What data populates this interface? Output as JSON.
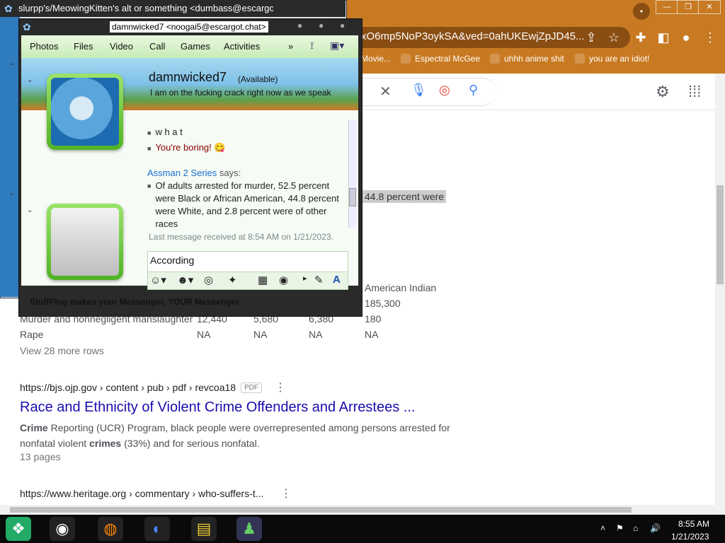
{
  "chrome": {
    "url": "xO6mp5NoP3oykSA&ved=0ahUKEwjZpJD45...",
    "profile_initial": "•",
    "window_buttons": [
      "—",
      "❐",
      "✕"
    ],
    "bookmarks": [
      {
        "label": "Movie..."
      },
      {
        "label": "Espectral McGee"
      },
      {
        "label": "uhhh anime shit"
      },
      {
        "label": "you are an idiot!"
      }
    ]
  },
  "search_page": {
    "highlighted_snippet": "44.8 percent were",
    "table": {
      "header_extra": "American Indian",
      "rows": [
        {
          "label": "",
          "cells": [
            "",
            "",
            "",
            "185,300"
          ]
        },
        {
          "label": "Murder and nonnegligent manslaughter",
          "cells": [
            "12,440",
            "5,680",
            "6,380",
            "180"
          ]
        },
        {
          "label": "Rape",
          "cells": [
            "NA",
            "NA",
            "NA",
            "NA"
          ]
        }
      ],
      "view_more": "View 28 more rows"
    },
    "result1": {
      "cite": "https://bjs.ojp.gov › content › pub › pdf › revcoa18",
      "badge": "PDF",
      "title": "Race and Ethnicity of Violent Crime Offenders and Arrestees ...",
      "snippet_bold1": "Crime",
      "snippet_text1": " Reporting (UCR) Program, black people were overrepresented among persons arrested for nonfatal violent ",
      "snippet_bold2": "crimes",
      "snippet_text2": " (33%) and for serious nonfatal.",
      "pages": "13 pages"
    },
    "result2": {
      "cite": "https://www.heritage.org › commentary › who-suffers-t..."
    }
  },
  "bg_window": {
    "title": "slurpp's/MeowingKitten's alt or something <dumbass@escargot..."
  },
  "messenger": {
    "title": "damnwicked7 <noogai5@escargot.chat>",
    "menu": [
      "Photos",
      "Files",
      "Video",
      "Call",
      "Games",
      "Activities",
      "»"
    ],
    "contact_name": "damnwicked7",
    "contact_status": "(Available)",
    "contact_psm": "I am on the fucking crack right now as we speak",
    "messages": {
      "line1": "w h a t",
      "line2": "You're boring!",
      "sender": "Assman 2 Series",
      "says": " says:",
      "body": "Of adults arrested for murder, 52.5 percent were Black or African American, 44.8 percent were White, and 2.8 percent were of other races"
    },
    "last_received": "Last message received at 8:54 AM on 1/21/2023.",
    "input_value": "According",
    "footer": "StuffPlug makes your Messenger, YOUR Messenger"
  },
  "taskbar": {
    "time": "8:55 AM",
    "date": "1/21/2023"
  },
  "colors": {
    "chrome_frame": "#c87a22",
    "link_blue": "#1a0dab",
    "wlm_green": "#4fb324"
  }
}
